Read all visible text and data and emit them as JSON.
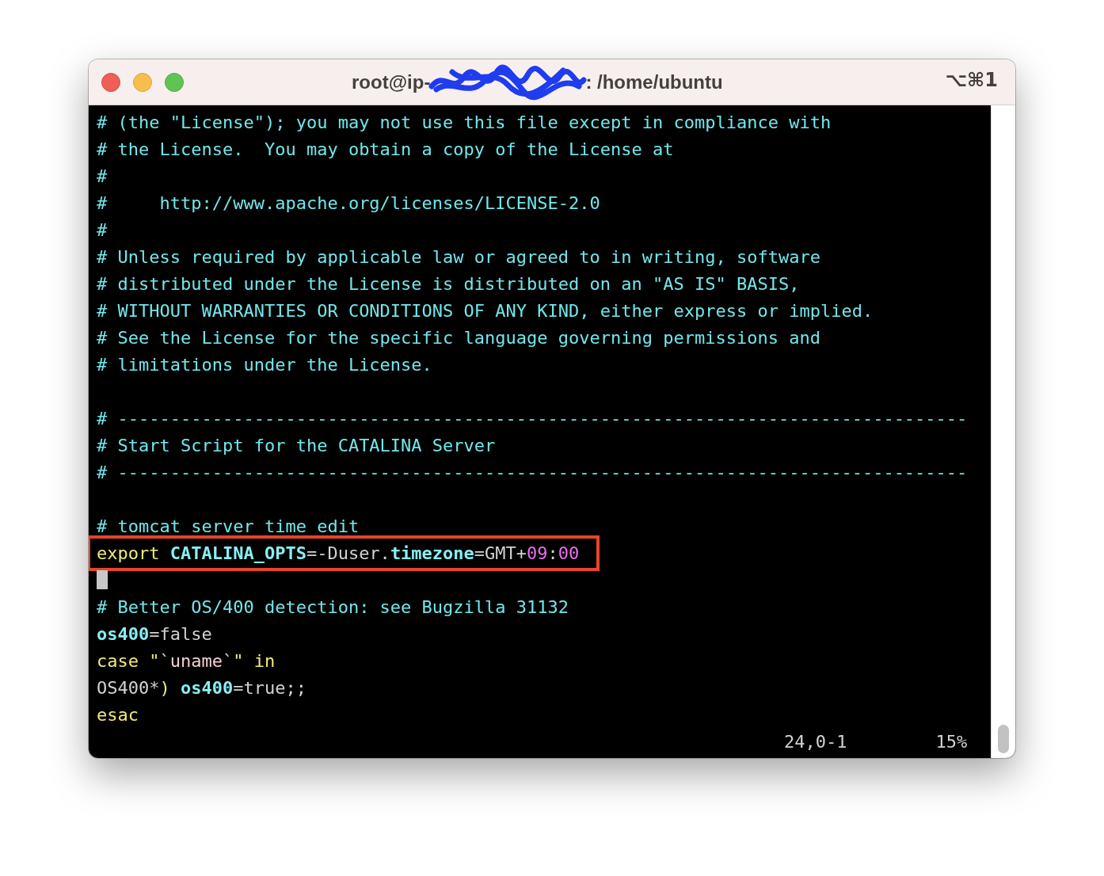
{
  "window": {
    "title_start": "root@ip-",
    "title_end": ": /home/ubuntu",
    "shortcut": "⌥⌘1"
  },
  "lines": [
    {
      "kind": "text",
      "segments": [
        {
          "kind": "comment",
          "text": "# (the \"License\"); you may not use this file except in compliance with"
        }
      ]
    },
    {
      "kind": "text",
      "segments": [
        {
          "kind": "comment",
          "text": "# the License.  You may obtain a copy of the License at"
        }
      ]
    },
    {
      "kind": "text",
      "segments": [
        {
          "kind": "comment",
          "text": "#"
        }
      ]
    },
    {
      "kind": "text",
      "segments": [
        {
          "kind": "comment",
          "text": "#     http://www.apache.org/licenses/LICENSE-2.0"
        }
      ]
    },
    {
      "kind": "text",
      "segments": [
        {
          "kind": "comment",
          "text": "#"
        }
      ]
    },
    {
      "kind": "text",
      "segments": [
        {
          "kind": "comment",
          "text": "# Unless required by applicable law or agreed to in writing, software"
        }
      ]
    },
    {
      "kind": "text",
      "segments": [
        {
          "kind": "comment",
          "text": "# distributed under the License is distributed on an \"AS IS\" BASIS,"
        }
      ]
    },
    {
      "kind": "text",
      "segments": [
        {
          "kind": "comment",
          "text": "# WITHOUT WARRANTIES OR CONDITIONS OF ANY KIND, either express or implied."
        }
      ]
    },
    {
      "kind": "text",
      "segments": [
        {
          "kind": "comment",
          "text": "# See the License for the specific language governing permissions and"
        }
      ]
    },
    {
      "kind": "text",
      "segments": [
        {
          "kind": "comment",
          "text": "# limitations under the License."
        }
      ]
    },
    {
      "kind": "blank"
    },
    {
      "kind": "text",
      "segments": [
        {
          "kind": "comment",
          "text": "# ---------------------------------------------------------------------------------"
        }
      ]
    },
    {
      "kind": "text",
      "segments": [
        {
          "kind": "comment",
          "text": "# Start Script for the CATALINA Server"
        }
      ]
    },
    {
      "kind": "text",
      "segments": [
        {
          "kind": "comment",
          "text": "# ---------------------------------------------------------------------------------"
        }
      ]
    },
    {
      "kind": "blank"
    },
    {
      "kind": "text",
      "segments": [
        {
          "kind": "comment",
          "text": "# tomcat server time edit"
        }
      ]
    },
    {
      "kind": "highlighted",
      "segments": [
        {
          "kind": "keyword",
          "text": "export "
        },
        {
          "kind": "variable",
          "text": "CATALINA_OPTS"
        },
        {
          "kind": "plain",
          "text": "=-Duser."
        },
        {
          "kind": "variable",
          "text": "timezone"
        },
        {
          "kind": "plain",
          "text": "=GMT+"
        },
        {
          "kind": "number",
          "text": "09"
        },
        {
          "kind": "plain",
          "text": ":"
        },
        {
          "kind": "number",
          "text": "00"
        }
      ]
    },
    {
      "kind": "cursor"
    },
    {
      "kind": "text",
      "segments": [
        {
          "kind": "comment",
          "text": "# Better OS/400 detection: see Bugzilla 31132"
        }
      ]
    },
    {
      "kind": "text",
      "segments": [
        {
          "kind": "variable",
          "text": "os400"
        },
        {
          "kind": "plain",
          "text": "=false"
        }
      ]
    },
    {
      "kind": "text",
      "segments": [
        {
          "kind": "keyword",
          "text": "case \""
        },
        {
          "kind": "string",
          "text": "`uname`"
        },
        {
          "kind": "keyword",
          "text": "\" in"
        }
      ]
    },
    {
      "kind": "text",
      "segments": [
        {
          "kind": "plain",
          "text": "OS400*"
        },
        {
          "kind": "keyword",
          "text": ") "
        },
        {
          "kind": "variable",
          "text": "os400"
        },
        {
          "kind": "plain",
          "text": "=true;;"
        }
      ]
    },
    {
      "kind": "text",
      "segments": [
        {
          "kind": "keyword",
          "text": "esac"
        }
      ]
    }
  ],
  "status": {
    "position": "24,0-1",
    "percent": "15%"
  }
}
